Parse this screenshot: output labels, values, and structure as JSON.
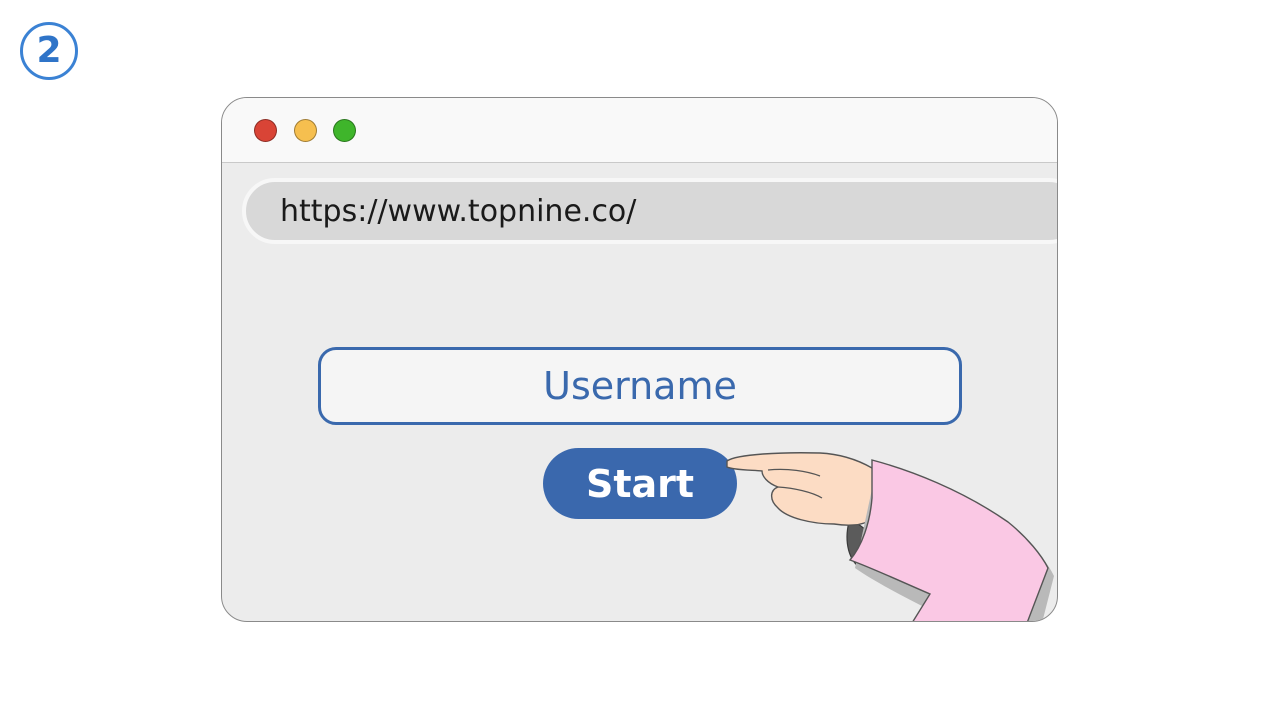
{
  "step": {
    "number": "2",
    "color": "#3b82d4"
  },
  "window": {
    "controls": [
      {
        "name": "close",
        "color": "#d94436"
      },
      {
        "name": "minimize",
        "color": "#f6bf4f"
      },
      {
        "name": "maximize",
        "color": "#3fb52b"
      }
    ]
  },
  "address_bar": {
    "url": "https://www.topnine.co/"
  },
  "form": {
    "username_placeholder": "Username",
    "start_label": "Start",
    "accent_color": "#3a68ad"
  },
  "illustration": {
    "hand_icon": "pointing-hand-icon",
    "sleeve_color": "#fac8e4"
  }
}
